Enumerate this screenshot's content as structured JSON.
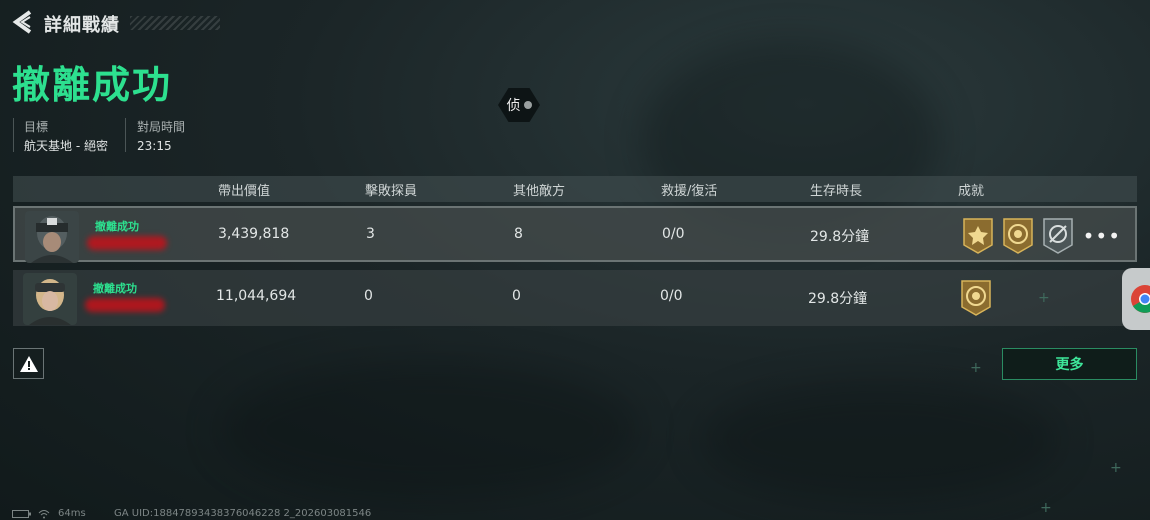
{
  "header": {
    "title": "詳細戰績"
  },
  "status_big": "撤離成功",
  "info": {
    "target_label": "目標",
    "target_value": "航天基地 - 絕密",
    "time_label": "對局時間",
    "time_value": "23:15"
  },
  "spy_badge": "侦",
  "table": {
    "headers": [
      "帶出價值",
      "擊敗探員",
      "其他敵方",
      "救援/復活",
      "生存時長",
      "成就"
    ],
    "rows": [
      {
        "status": "撤離成功",
        "value": "3,439,818",
        "kills": "3",
        "others": "8",
        "rescue": "0/0",
        "survival": "29.8分鐘"
      },
      {
        "status": "撤離成功",
        "value": "11,044,694",
        "kills": "0",
        "others": "0",
        "rescue": "0/0",
        "survival": "29.8分鐘"
      }
    ]
  },
  "more_menu": "•••",
  "more_button": "更多",
  "footer": {
    "ping": "64ms",
    "uid": "GA UID:18847893438376046228 2_202603081546"
  },
  "colors": {
    "accent_green": "#2de08f",
    "name_redaction": "#c4121a"
  }
}
